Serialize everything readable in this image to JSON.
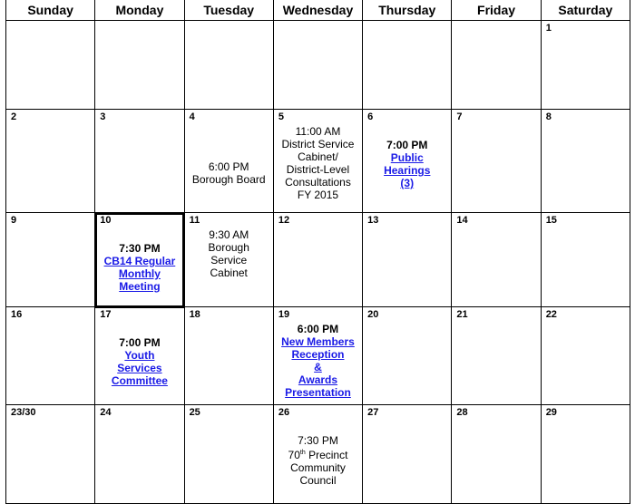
{
  "calendar": {
    "weekdays": [
      "Sunday",
      "Monday",
      "Tuesday",
      "Wednesday",
      "Thursday",
      "Friday",
      "Saturday"
    ],
    "weeks": [
      {
        "days": [
          {
            "num": ""
          },
          {
            "num": ""
          },
          {
            "num": ""
          },
          {
            "num": ""
          },
          {
            "num": ""
          },
          {
            "num": ""
          },
          {
            "num": "1"
          }
        ]
      },
      {
        "days": [
          {
            "num": "2"
          },
          {
            "num": "3"
          },
          {
            "num": "4",
            "event": {
              "time": "6:00 PM",
              "title_lines": [
                "Borough Board"
              ],
              "link": false
            }
          },
          {
            "num": "5",
            "event": {
              "time": "11:00 AM",
              "title_lines": [
                "District Service",
                "Cabinet/",
                "District-Level",
                "Consultations",
                "FY 2015"
              ],
              "link": false
            }
          },
          {
            "num": "6",
            "event": {
              "time": "7:00 PM",
              "title_lines": [
                "Public",
                "Hearings",
                "(3)"
              ],
              "link": true
            }
          },
          {
            "num": "7"
          },
          {
            "num": "8"
          }
        ]
      },
      {
        "days": [
          {
            "num": "9"
          },
          {
            "num": "10",
            "selected": true,
            "event": {
              "time": "7:30 PM",
              "title_lines": [
                "CB14 Regular",
                "Monthly",
                "Meeting"
              ],
              "link": true
            }
          },
          {
            "num": "11",
            "event": {
              "time": "9:30 AM",
              "title_lines": [
                "Borough",
                "Service",
                "Cabinet"
              ],
              "link": false
            }
          },
          {
            "num": "12"
          },
          {
            "num": "13"
          },
          {
            "num": "14"
          },
          {
            "num": "15"
          }
        ]
      },
      {
        "days": [
          {
            "num": "16"
          },
          {
            "num": "17",
            "event": {
              "time": "7:00 PM",
              "title_lines": [
                "Youth",
                "Services",
                "Committee"
              ],
              "link": true
            }
          },
          {
            "num": "18"
          },
          {
            "num": "19",
            "event": {
              "time": "6:00 PM",
              "title_lines": [
                "New Members",
                "Reception",
                "&",
                "Awards",
                "Presentation"
              ],
              "link": true
            }
          },
          {
            "num": "20"
          },
          {
            "num": "21"
          },
          {
            "num": "22"
          }
        ]
      },
      {
        "days": [
          {
            "num": "23/30"
          },
          {
            "num": "24"
          },
          {
            "num": "25"
          },
          {
            "num": "26",
            "event": {
              "time": "7:30 PM",
              "title_lines": [
                "70th Precinct",
                "Community",
                "Council"
              ],
              "link": false
            }
          },
          {
            "num": "27"
          },
          {
            "num": "28"
          },
          {
            "num": "29"
          }
        ]
      }
    ]
  },
  "colors": {
    "link": "#1a1ae6",
    "grid": "#000000"
  }
}
